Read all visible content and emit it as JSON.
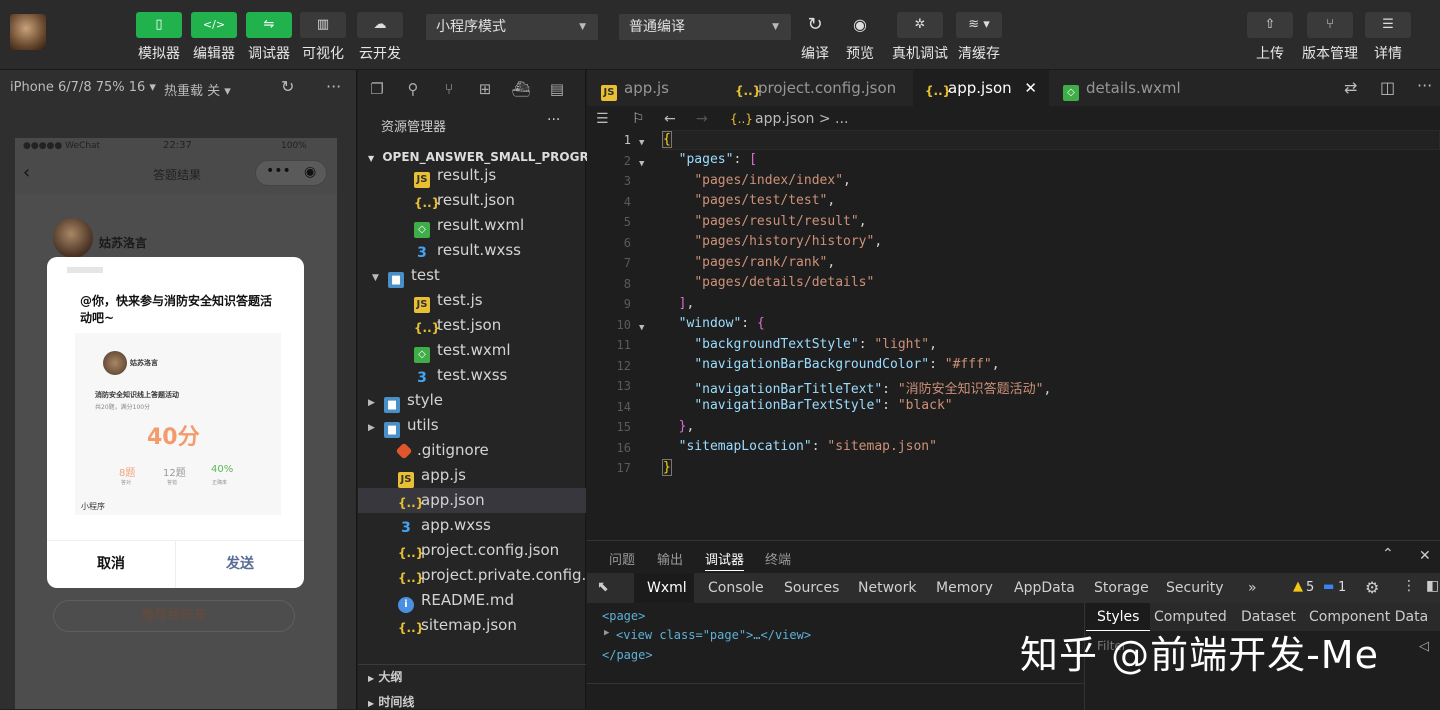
{
  "toolbar": {
    "simulator": "模拟器",
    "editor": "编辑器",
    "debugger": "调试器",
    "visual": "可视化",
    "cloud": "云开发",
    "mode": "小程序模式",
    "compile_mode": "普通编译",
    "compile": "编译",
    "preview": "预览",
    "real_debug": "真机调试",
    "clear_cache": "清缓存",
    "upload": "上传",
    "version": "版本管理",
    "details": "详情"
  },
  "sim": {
    "device": "iPhone 6/7/8 75% 16 ▾",
    "hot_reload": "热重载 关 ▾",
    "status_left": "●●●●● WeChat",
    "status_time": "22:37",
    "status_right": "100%",
    "nav_title": "答题结果",
    "user_name": "姑苏洛言",
    "share_text": "@你，快来参与消防安全知识答题活动吧~",
    "card_user": "姑苏洛言",
    "card_title": "消防安全知识线上答题活动",
    "card_sub": "共20题，满分100分",
    "score": "40分",
    "stat1_val": "8题",
    "stat1_lbl": "答对",
    "stat2_val": "12题",
    "stat2_lbl": "答错",
    "stat3_val": "40%",
    "stat3_lbl": "正确率",
    "mini_label": "小程序",
    "cancel": "取消",
    "send": "发送",
    "recommend": "推荐给好友"
  },
  "explorer": {
    "title": "资源管理器",
    "project": "OPEN_ANSWER_SMALL_PROGR...",
    "items": [
      {
        "name": "result.js",
        "type": "js"
      },
      {
        "name": "result.json",
        "type": "json"
      },
      {
        "name": "result.wxml",
        "type": "wxml"
      },
      {
        "name": "result.wxss",
        "type": "wxss"
      },
      {
        "name": "test",
        "type": "folder"
      },
      {
        "name": "test.js",
        "type": "js"
      },
      {
        "name": "test.json",
        "type": "json"
      },
      {
        "name": "test.wxml",
        "type": "wxml"
      },
      {
        "name": "test.wxss",
        "type": "wxss"
      },
      {
        "name": "style",
        "type": "folder"
      },
      {
        "name": "utils",
        "type": "folder"
      },
      {
        "name": ".gitignore",
        "type": "git"
      },
      {
        "name": "app.js",
        "type": "js"
      },
      {
        "name": "app.json",
        "type": "json"
      },
      {
        "name": "app.wxss",
        "type": "wxss"
      },
      {
        "name": "project.config.json",
        "type": "json"
      },
      {
        "name": "project.private.config.js...",
        "type": "json"
      },
      {
        "name": "README.md",
        "type": "md"
      },
      {
        "name": "sitemap.json",
        "type": "json"
      }
    ],
    "outline": "大纲",
    "timeline": "时间线"
  },
  "editor": {
    "tabs": [
      "app.js",
      "project.config.json",
      "app.json",
      "details.wxml"
    ],
    "crumb": "app.json > ...",
    "line_numbers": [
      "1",
      "2",
      "3",
      "4",
      "5",
      "6",
      "7",
      "8",
      "9",
      "10",
      "11",
      "12",
      "13",
      "14",
      "15",
      "16",
      "17"
    ]
  },
  "code": {
    "pages_key": "\"pages\"",
    "p1": "\"pages/index/index\"",
    "p2": "\"pages/test/test\"",
    "p3": "\"pages/result/result\"",
    "p4": "\"pages/history/history\"",
    "p5": "\"pages/rank/rank\"",
    "p6": "\"pages/details/details\"",
    "window_key": "\"window\"",
    "bg_key": "\"backgroundTextStyle\"",
    "bg_val": "\"light\"",
    "nbc_key": "\"navigationBarBackgroundColor\"",
    "nbc_val": "\"#fff\"",
    "nbt_key": "\"navigationBarTitleText\"",
    "nbt_val": "\"消防安全知识答题活动\"",
    "nbs_key": "\"navigationBarTextStyle\"",
    "nbs_val": "\"black\"",
    "sm_key": "\"sitemapLocation\"",
    "sm_val": "\"sitemap.json\""
  },
  "panel": {
    "tabs": [
      "问题",
      "输出",
      "调试器",
      "终端"
    ],
    "devtabs": [
      "Wxml",
      "Console",
      "Sources",
      "Network",
      "Memory",
      "AppData",
      "Storage",
      "Security",
      "»"
    ],
    "warn_count": "5",
    "info_count": "1",
    "dom_page_open": "<page>",
    "dom_view": "<view class=\"page\">…</view>",
    "dom_page_close": "</page>",
    "style_tabs": [
      "Styles",
      "Computed",
      "Dataset",
      "Component Data"
    ],
    "filter": "Filter"
  },
  "watermark": "知乎 @前端开发-Me"
}
